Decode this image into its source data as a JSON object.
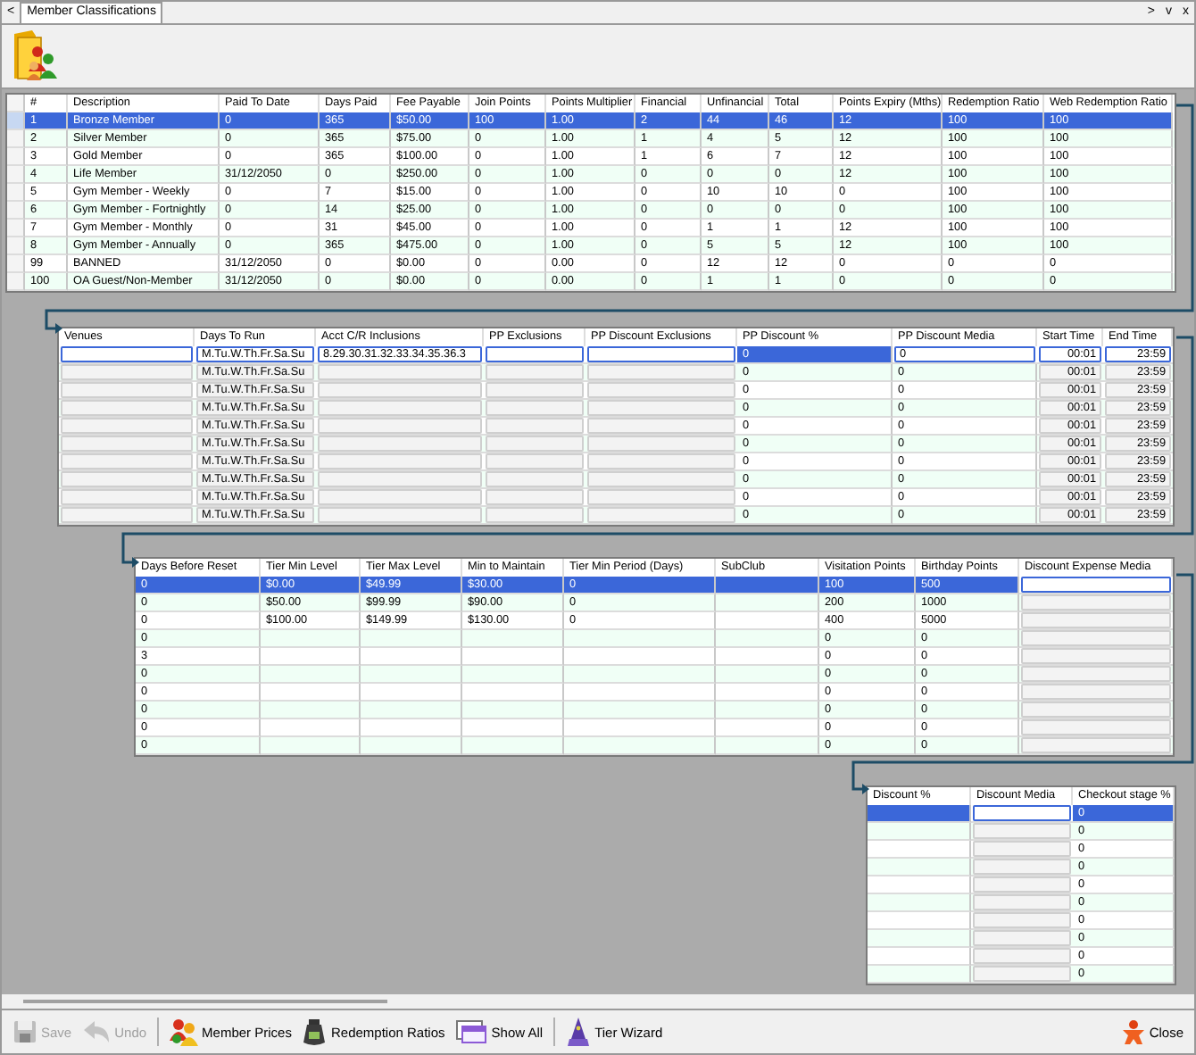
{
  "tabstrip": {
    "prev": "<",
    "tabs": [
      {
        "label": "Member Classifications",
        "selected": true
      }
    ],
    "next": ">",
    "menu": "v",
    "close": "x"
  },
  "grids": [
    {
      "columns": [
        {
          "label": "#",
          "kind": "text"
        },
        {
          "label": "Description",
          "kind": "text"
        },
        {
          "label": "Paid To Date",
          "kind": "text"
        },
        {
          "label": "Days Paid",
          "kind": "text"
        },
        {
          "label": "Fee Payable",
          "kind": "text"
        },
        {
          "label": "Join Points",
          "kind": "text"
        },
        {
          "label": "Points Multiplier",
          "kind": "text"
        },
        {
          "label": "Financial",
          "kind": "text"
        },
        {
          "label": "Unfinancial",
          "kind": "text"
        },
        {
          "label": "Total",
          "kind": "text"
        },
        {
          "label": "Points Expiry (Mths)",
          "kind": "text"
        },
        {
          "label": "Redemption Ratio",
          "kind": "text"
        },
        {
          "label": "Web Redemption Ratio",
          "kind": "text"
        }
      ],
      "rows": [
        {
          "selected": true,
          "cells": [
            "1",
            "Bronze Member",
            "0",
            "365",
            "$50.00",
            "100",
            "1.00",
            "2",
            "44",
            "46",
            "12",
            "100",
            "100"
          ]
        },
        {
          "selected": false,
          "cells": [
            "2",
            "Silver Member",
            "0",
            "365",
            "$75.00",
            "0",
            "1.00",
            "1",
            "4",
            "5",
            "12",
            "100",
            "100"
          ]
        },
        {
          "selected": false,
          "cells": [
            "3",
            "Gold Member",
            "0",
            "365",
            "$100.00",
            "0",
            "1.00",
            "1",
            "6",
            "7",
            "12",
            "100",
            "100"
          ]
        },
        {
          "selected": false,
          "cells": [
            "4",
            "Life Member",
            "31/12/2050",
            "0",
            "$250.00",
            "0",
            "1.00",
            "0",
            "0",
            "0",
            "12",
            "100",
            "100"
          ]
        },
        {
          "selected": false,
          "cells": [
            "5",
            "Gym Member - Weekly",
            "0",
            "7",
            "$15.00",
            "0",
            "1.00",
            "0",
            "10",
            "10",
            "0",
            "100",
            "100"
          ]
        },
        {
          "selected": false,
          "cells": [
            "6",
            "Gym Member - Fortnightly",
            "0",
            "14",
            "$25.00",
            "0",
            "1.00",
            "0",
            "0",
            "0",
            "0",
            "100",
            "100"
          ]
        },
        {
          "selected": false,
          "cells": [
            "7",
            "Gym Member - Monthly",
            "0",
            "31",
            "$45.00",
            "0",
            "1.00",
            "0",
            "1",
            "1",
            "12",
            "100",
            "100"
          ]
        },
        {
          "selected": false,
          "cells": [
            "8",
            "Gym Member - Annually",
            "0",
            "365",
            "$475.00",
            "0",
            "1.00",
            "0",
            "5",
            "5",
            "12",
            "100",
            "100"
          ]
        },
        {
          "selected": false,
          "cells": [
            "99",
            "BANNED",
            "31/12/2050",
            "0",
            "$0.00",
            "0",
            "0.00",
            "0",
            "12",
            "12",
            "0",
            "0",
            "0"
          ]
        },
        {
          "selected": false,
          "cells": [
            "100",
            "OA Guest/Non-Member",
            "31/12/2050",
            "0",
            "$0.00",
            "0",
            "0.00",
            "0",
            "1",
            "1",
            "0",
            "0",
            "0"
          ]
        }
      ]
    },
    {
      "columns": [
        {
          "label": "Venues",
          "kind": "box"
        },
        {
          "label": "Days To Run",
          "kind": "box"
        },
        {
          "label": "Acct C/R Inclusions",
          "kind": "box"
        },
        {
          "label": "PP Exclusions",
          "kind": "box"
        },
        {
          "label": "PP Discount Exclusions",
          "kind": "box"
        },
        {
          "label": "PP Discount %",
          "kind": "text"
        },
        {
          "label": "PP Discount Media",
          "kind": "edit"
        },
        {
          "label": "Start Time",
          "kind": "time"
        },
        {
          "label": "End Time",
          "kind": "time"
        }
      ],
      "rows": [
        {
          "selected": true,
          "cells": [
            null,
            "M.Tu.W.Th.Fr.Sa.Su",
            "8.29.30.31.32.33.34.35.36.3",
            null,
            null,
            "0",
            "0",
            "00:01",
            "23:59"
          ]
        },
        {
          "selected": false,
          "cells": [
            null,
            "M.Tu.W.Th.Fr.Sa.Su",
            null,
            null,
            null,
            "0",
            "0",
            "00:01",
            "23:59"
          ]
        },
        {
          "selected": false,
          "cells": [
            null,
            "M.Tu.W.Th.Fr.Sa.Su",
            null,
            null,
            null,
            "0",
            "0",
            "00:01",
            "23:59"
          ]
        },
        {
          "selected": false,
          "cells": [
            null,
            "M.Tu.W.Th.Fr.Sa.Su",
            null,
            null,
            null,
            "0",
            "0",
            "00:01",
            "23:59"
          ]
        },
        {
          "selected": false,
          "cells": [
            null,
            "M.Tu.W.Th.Fr.Sa.Su",
            null,
            null,
            null,
            "0",
            "0",
            "00:01",
            "23:59"
          ]
        },
        {
          "selected": false,
          "cells": [
            null,
            "M.Tu.W.Th.Fr.Sa.Su",
            null,
            null,
            null,
            "0",
            "0",
            "00:01",
            "23:59"
          ]
        },
        {
          "selected": false,
          "cells": [
            null,
            "M.Tu.W.Th.Fr.Sa.Su",
            null,
            null,
            null,
            "0",
            "0",
            "00:01",
            "23:59"
          ]
        },
        {
          "selected": false,
          "cells": [
            null,
            "M.Tu.W.Th.Fr.Sa.Su",
            null,
            null,
            null,
            "0",
            "0",
            "00:01",
            "23:59"
          ]
        },
        {
          "selected": false,
          "cells": [
            null,
            "M.Tu.W.Th.Fr.Sa.Su",
            null,
            null,
            null,
            "0",
            "0",
            "00:01",
            "23:59"
          ]
        },
        {
          "selected": false,
          "cells": [
            null,
            "M.Tu.W.Th.Fr.Sa.Su",
            null,
            null,
            null,
            "0",
            "0",
            "00:01",
            "23:59"
          ]
        }
      ]
    },
    {
      "columns": [
        {
          "label": "Days Before Reset",
          "kind": "text"
        },
        {
          "label": "Tier Min Level",
          "kind": "text"
        },
        {
          "label": "Tier Max Level",
          "kind": "text"
        },
        {
          "label": "Min to Maintain",
          "kind": "text"
        },
        {
          "label": "Tier Min Period (Days)",
          "kind": "text"
        },
        {
          "label": "SubClub",
          "kind": "text"
        },
        {
          "label": "Visitation Points",
          "kind": "text"
        },
        {
          "label": "Birthday Points",
          "kind": "text"
        },
        {
          "label": "Discount Expense Media",
          "kind": "box"
        }
      ],
      "rows": [
        {
          "selected": true,
          "cells": [
            "0",
            "$0.00",
            "$49.99",
            "$30.00",
            "0",
            null,
            "100",
            "500",
            null
          ]
        },
        {
          "selected": false,
          "cells": [
            "0",
            "$50.00",
            "$99.99",
            "$90.00",
            "0",
            null,
            "200",
            "1000",
            null
          ]
        },
        {
          "selected": false,
          "cells": [
            "0",
            "$100.00",
            "$149.99",
            "$130.00",
            "0",
            null,
            "400",
            "5000",
            null
          ]
        },
        {
          "selected": false,
          "cells": [
            "0",
            null,
            null,
            null,
            null,
            null,
            "0",
            "0",
            null
          ]
        },
        {
          "selected": false,
          "cells": [
            "3",
            null,
            null,
            null,
            null,
            null,
            "0",
            "0",
            null
          ]
        },
        {
          "selected": false,
          "cells": [
            "0",
            null,
            null,
            null,
            null,
            null,
            "0",
            "0",
            null
          ]
        },
        {
          "selected": false,
          "cells": [
            "0",
            null,
            null,
            null,
            null,
            null,
            "0",
            "0",
            null
          ]
        },
        {
          "selected": false,
          "cells": [
            "0",
            null,
            null,
            null,
            null,
            null,
            "0",
            "0",
            null
          ]
        },
        {
          "selected": false,
          "cells": [
            "0",
            null,
            null,
            null,
            null,
            null,
            "0",
            "0",
            null
          ]
        },
        {
          "selected": false,
          "cells": [
            "0",
            null,
            null,
            null,
            null,
            null,
            "0",
            "0",
            null
          ]
        }
      ]
    },
    {
      "columns": [
        {
          "label": "Discount %",
          "kind": "text"
        },
        {
          "label": "Discount Media",
          "kind": "box"
        },
        {
          "label": "Checkout stage %",
          "kind": "text"
        }
      ],
      "rows": [
        {
          "selected": true,
          "cells": [
            null,
            null,
            "0"
          ]
        },
        {
          "selected": false,
          "cells": [
            null,
            null,
            "0"
          ]
        },
        {
          "selected": false,
          "cells": [
            null,
            null,
            "0"
          ]
        },
        {
          "selected": false,
          "cells": [
            null,
            null,
            "0"
          ]
        },
        {
          "selected": false,
          "cells": [
            null,
            null,
            "0"
          ]
        },
        {
          "selected": false,
          "cells": [
            null,
            null,
            "0"
          ]
        },
        {
          "selected": false,
          "cells": [
            null,
            null,
            "0"
          ]
        },
        {
          "selected": false,
          "cells": [
            null,
            null,
            "0"
          ]
        },
        {
          "selected": false,
          "cells": [
            null,
            null,
            "0"
          ]
        },
        {
          "selected": false,
          "cells": [
            null,
            null,
            "0"
          ]
        }
      ]
    }
  ],
  "toolbar": {
    "buttons": [
      {
        "label": "Save",
        "kind": "save",
        "disabled": true,
        "separated": false
      },
      {
        "label": "Undo",
        "kind": "undo",
        "disabled": true,
        "separated": false
      },
      {
        "label": "Member Prices",
        "kind": "people",
        "disabled": false,
        "separated": true
      },
      {
        "label": "Redemption Ratios",
        "kind": "jar",
        "disabled": false,
        "separated": false
      },
      {
        "label": "Show All",
        "kind": "window",
        "disabled": false,
        "separated": false
      },
      {
        "label": "Tier Wizard",
        "kind": "wizard",
        "disabled": false,
        "separated": true
      }
    ],
    "close": {
      "label": "Close",
      "kind": "close",
      "disabled": false
    }
  }
}
